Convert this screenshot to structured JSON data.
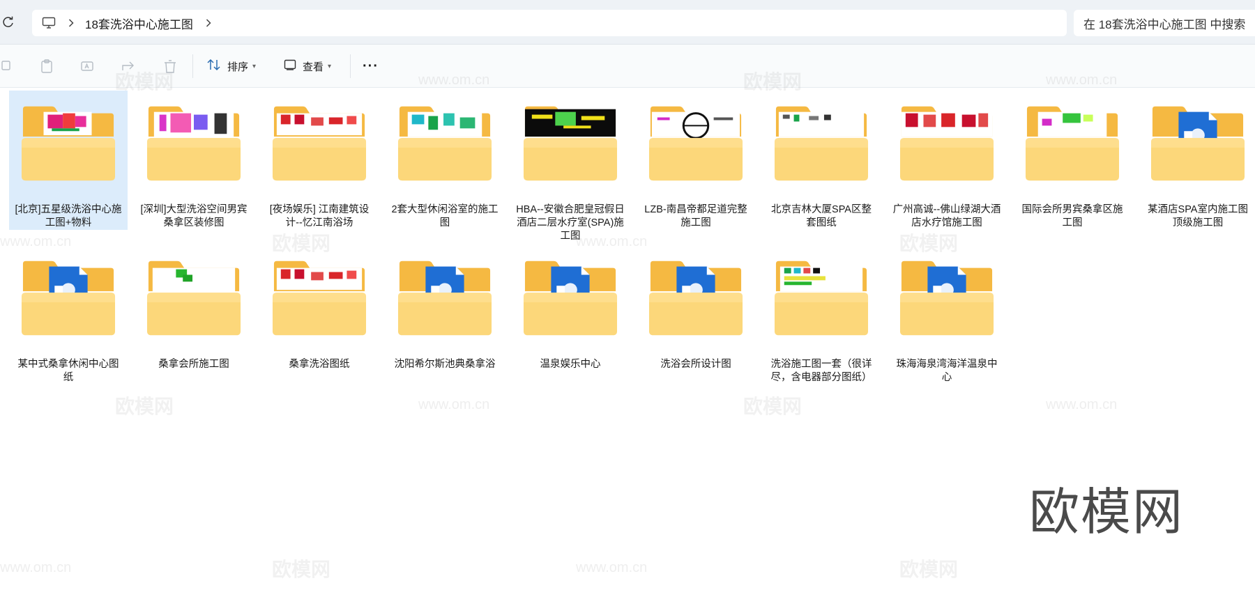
{
  "address": {
    "path": [
      "18套洗浴中心施工图"
    ]
  },
  "search": {
    "placeholder": "在 18套洗浴中心施工图 中搜索"
  },
  "toolbar": {
    "sort_label": "排序",
    "view_label": "查看",
    "more_label": "···"
  },
  "items": [
    {
      "label": "[北京]五星级洗浴中心施工图+物料",
      "thumb": "cad-red",
      "selected": true
    },
    {
      "label": "[深圳]大型洗浴空间男宾桑拿区装修图",
      "thumb": "cad-magenta",
      "selected": false
    },
    {
      "label": "[夜场娱乐] 江南建筑设计--忆江南浴场",
      "thumb": "cad-red-grid",
      "selected": false
    },
    {
      "label": "2套大型休闲浴室的施工图",
      "thumb": "cad-cyan",
      "selected": false
    },
    {
      "label": "HBA--安徽合肥皇冠假日酒店二层水疗室(SPA)施工图",
      "thumb": "cad-dark",
      "selected": false
    },
    {
      "label": "LZB-南昌帝都足道完整施工图",
      "thumb": "cad-circle",
      "selected": false
    },
    {
      "label": "北京吉林大厦SPA区整套图纸",
      "thumb": "cad-sparse",
      "selected": false
    },
    {
      "label": "广州高诚--佛山绿湖大酒店水疗馆施工图",
      "thumb": "cad-red-blocks",
      "selected": false
    },
    {
      "label": "国际会所男宾桑拿区施工图",
      "thumb": "cad-green",
      "selected": false
    },
    {
      "label": "某酒店SPA室内施工图顶级施工图",
      "thumb": "dwg-file",
      "selected": false
    },
    {
      "label": "某中式桑拿休闲中心图纸",
      "thumb": "dwg-file",
      "selected": false
    },
    {
      "label": "桑拿会所施工图",
      "thumb": "cad-green-small",
      "selected": false
    },
    {
      "label": "桑拿洗浴图纸",
      "thumb": "cad-red-grid",
      "selected": false
    },
    {
      "label": "沈阳希尔斯池典桑拿浴",
      "thumb": "dwg-file",
      "selected": false
    },
    {
      "label": "温泉娱乐中心",
      "thumb": "dwg-file",
      "selected": false
    },
    {
      "label": "洗浴会所设计图",
      "thumb": "dwg-file",
      "selected": false
    },
    {
      "label": "洗浴施工图一套（很详尽，含电器部分图纸）",
      "thumb": "cad-mixed",
      "selected": false
    },
    {
      "label": "珠海海泉湾海洋温泉中心",
      "thumb": "dwg-file",
      "selected": false
    }
  ],
  "watermark": {
    "brand": "欧模网",
    "url": "www.om.cn",
    "logo": "欧模网"
  }
}
